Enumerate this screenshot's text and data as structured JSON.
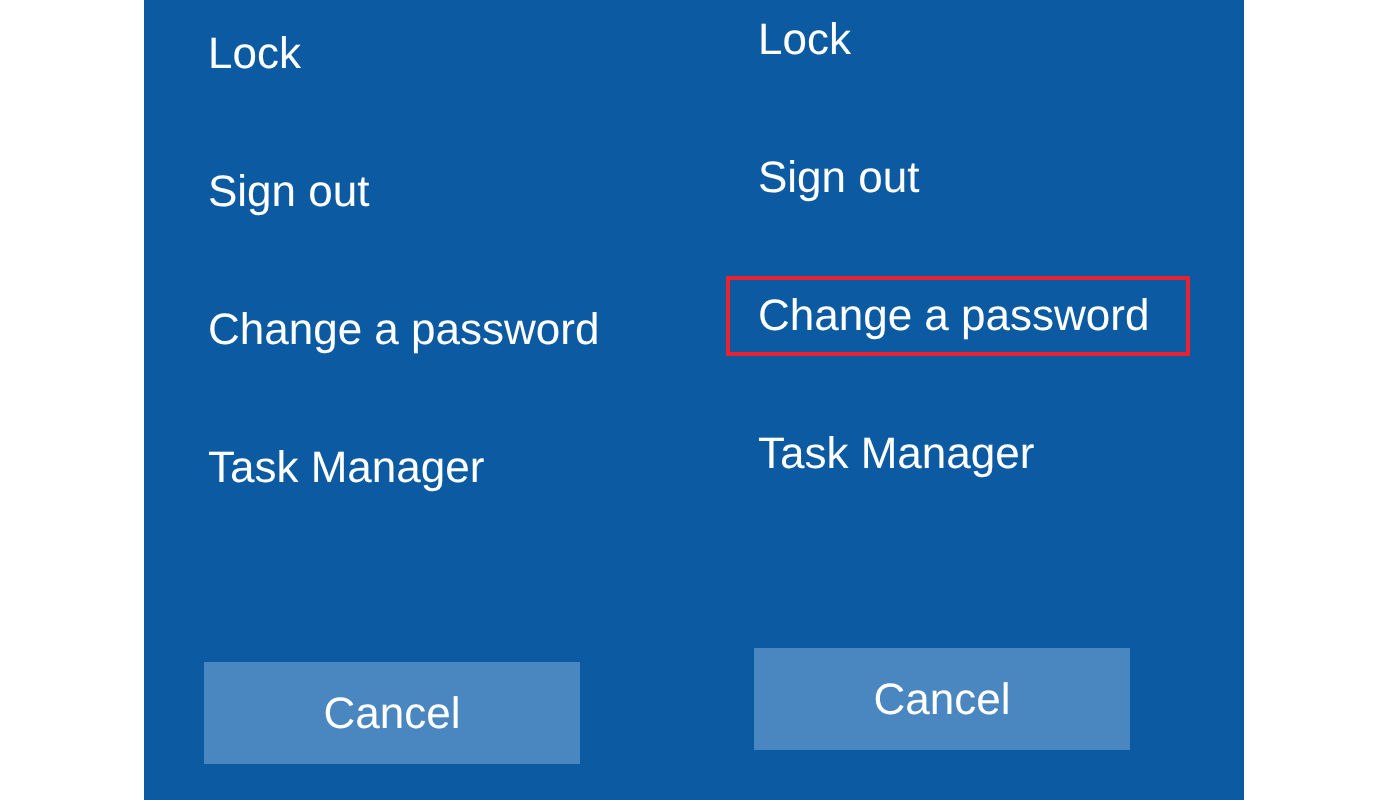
{
  "panels": [
    {
      "items": [
        {
          "label": "Lock",
          "highlighted": false
        },
        {
          "label": "Sign out",
          "highlighted": false
        },
        {
          "label": "Change a password",
          "highlighted": false
        },
        {
          "label": "Task Manager",
          "highlighted": false
        }
      ],
      "cancel": "Cancel"
    },
    {
      "items": [
        {
          "label": "Lock",
          "highlighted": false
        },
        {
          "label": "Sign out",
          "highlighted": false
        },
        {
          "label": "Change a password",
          "highlighted": true
        },
        {
          "label": "Task Manager",
          "highlighted": false
        }
      ],
      "cancel": "Cancel"
    }
  ]
}
